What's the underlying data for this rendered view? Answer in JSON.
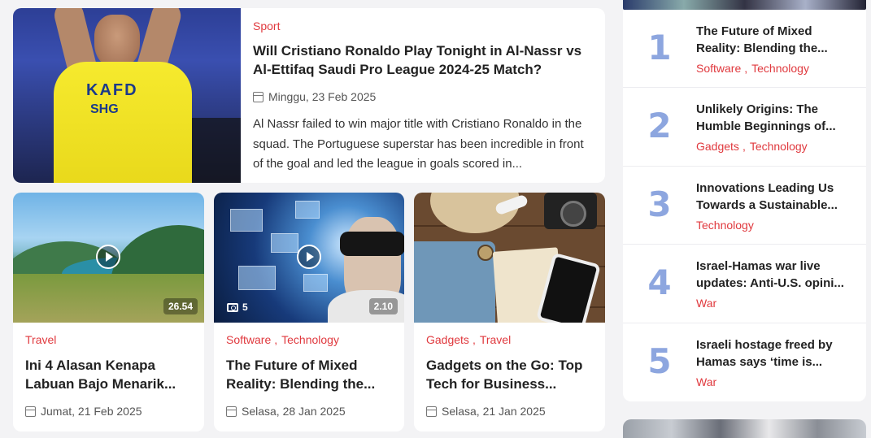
{
  "featured": {
    "category": "Sport",
    "title": "Will Cristiano Ronaldo Play Tonight in Al-Nassr vs Al-Ettifaq Saudi Pro League 2024-25 Match?",
    "date": "Minggu, 23 Feb 2025",
    "excerpt": "Al Nassr failed to win major title with Cristiano Ronaldo in the squad. The Portuguese superstar has been incredible in front of the goal and led the league in goals scored in...",
    "jersey_text": "KAFD",
    "jersey_sponsor": "SHG"
  },
  "cards": [
    {
      "categories": [
        "Travel"
      ],
      "title": "Ini 4 Alasan Kenapa Labuan Bajo Menarik...",
      "date": "Jumat, 21 Feb 2025",
      "duration": "26.54"
    },
    {
      "categories": [
        "Software",
        "Technology"
      ],
      "title": "The Future of Mixed Reality: Blending the...",
      "date": "Selasa, 28 Jan 2025",
      "duration": "2.10",
      "photo_count": "5"
    },
    {
      "categories": [
        "Gadgets",
        "Travel"
      ],
      "title": "Gadgets on the Go: Top Tech for Business...",
      "date": "Selasa, 21 Jan 2025"
    }
  ],
  "sidebar": {
    "items": [
      {
        "rank": "1",
        "title": "The Future of Mixed Reality: Blending the...",
        "categories": [
          "Software",
          "Technology"
        ]
      },
      {
        "rank": "2",
        "title": "Unlikely Origins: The Humble Beginnings of...",
        "categories": [
          "Gadgets",
          "Technology"
        ]
      },
      {
        "rank": "3",
        "title": "Innovations Leading Us Towards a Sustainable...",
        "categories": [
          "Technology"
        ]
      },
      {
        "rank": "4",
        "title": "Israel-Hamas war live updates: Anti-U.S. opini...",
        "categories": [
          "War"
        ]
      },
      {
        "rank": "5",
        "title": "Israeli hostage freed by Hamas says ‘time is...",
        "categories": [
          "War"
        ]
      }
    ]
  },
  "colors": {
    "category": "#e0393e",
    "rank_number": "#8da6df"
  },
  "icons": {
    "date": "calendar-icon",
    "video": "play-icon",
    "gallery": "camera-icon"
  }
}
